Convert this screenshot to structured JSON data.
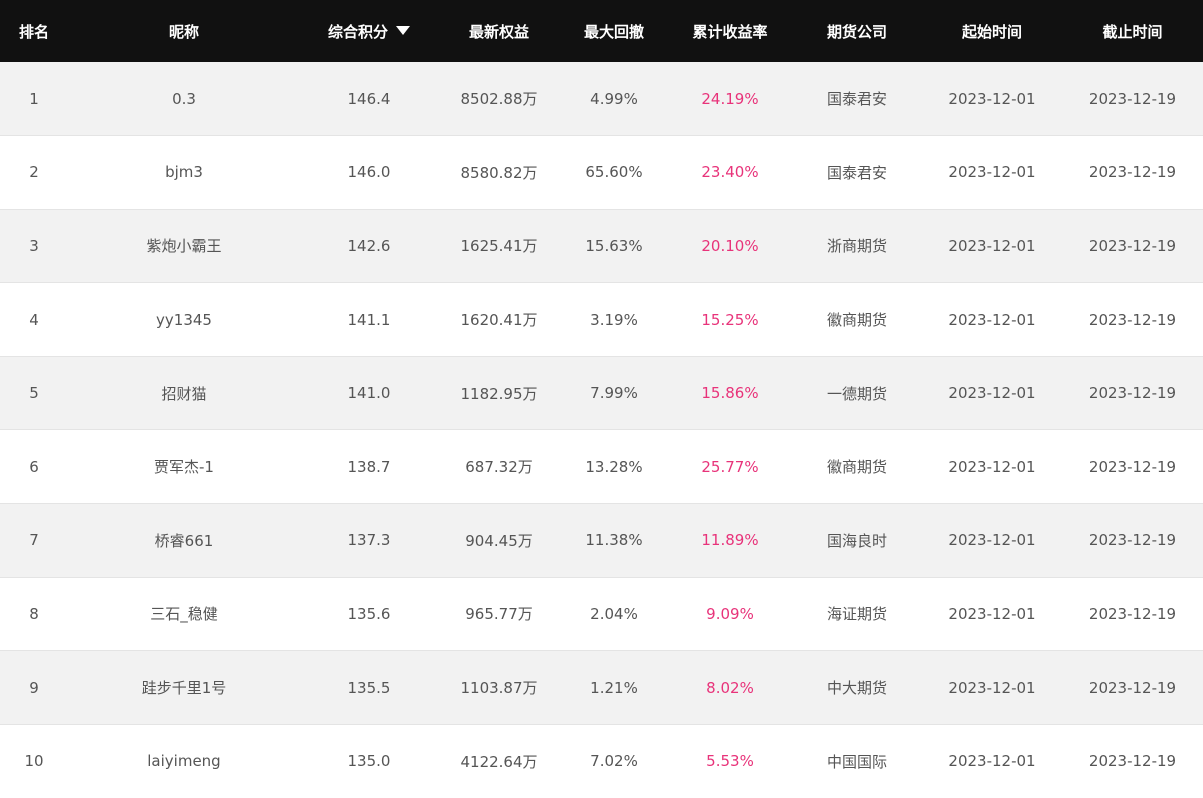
{
  "headers": {
    "rank": "排名",
    "nickname": "昵称",
    "score": "综合积分",
    "equity": "最新权益",
    "drawdown": "最大回撤",
    "return": "累计收益率",
    "company": "期货公司",
    "start": "起始时间",
    "end": "截止时间"
  },
  "sort_icon": "triangle-down-icon",
  "accent_color": "#e8337a",
  "rows": [
    {
      "rank": "1",
      "nickname": "0.3",
      "score": "146.4",
      "equity": "8502.88万",
      "drawdown": "4.99%",
      "return": "24.19%",
      "company": "国泰君安",
      "start": "2023-12-01",
      "end": "2023-12-19"
    },
    {
      "rank": "2",
      "nickname": "bjm3",
      "score": "146.0",
      "equity": "8580.82万",
      "drawdown": "65.60%",
      "return": "23.40%",
      "company": "国泰君安",
      "start": "2023-12-01",
      "end": "2023-12-19"
    },
    {
      "rank": "3",
      "nickname": "紫炮小霸王",
      "score": "142.6",
      "equity": "1625.41万",
      "drawdown": "15.63%",
      "return": "20.10%",
      "company": "浙商期货",
      "start": "2023-12-01",
      "end": "2023-12-19"
    },
    {
      "rank": "4",
      "nickname": "yy1345",
      "score": "141.1",
      "equity": "1620.41万",
      "drawdown": "3.19%",
      "return": "15.25%",
      "company": "徽商期货",
      "start": "2023-12-01",
      "end": "2023-12-19"
    },
    {
      "rank": "5",
      "nickname": "招财猫",
      "score": "141.0",
      "equity": "1182.95万",
      "drawdown": "7.99%",
      "return": "15.86%",
      "company": "一德期货",
      "start": "2023-12-01",
      "end": "2023-12-19"
    },
    {
      "rank": "6",
      "nickname": "贾军杰-1",
      "score": "138.7",
      "equity": "687.32万",
      "drawdown": "13.28%",
      "return": "25.77%",
      "company": "徽商期货",
      "start": "2023-12-01",
      "end": "2023-12-19"
    },
    {
      "rank": "7",
      "nickname": "桥睿661",
      "score": "137.3",
      "equity": "904.45万",
      "drawdown": "11.38%",
      "return": "11.89%",
      "company": "国海良时",
      "start": "2023-12-01",
      "end": "2023-12-19"
    },
    {
      "rank": "8",
      "nickname": "三石_稳健",
      "score": "135.6",
      "equity": "965.77万",
      "drawdown": "2.04%",
      "return": "9.09%",
      "company": "海证期货",
      "start": "2023-12-01",
      "end": "2023-12-19"
    },
    {
      "rank": "9",
      "nickname": "跬步千里1号",
      "score": "135.5",
      "equity": "1103.87万",
      "drawdown": "1.21%",
      "return": "8.02%",
      "company": "中大期货",
      "start": "2023-12-01",
      "end": "2023-12-19"
    },
    {
      "rank": "10",
      "nickname": "laiyimeng",
      "score": "135.0",
      "equity": "4122.64万",
      "drawdown": "7.02%",
      "return": "5.53%",
      "company": "中国国际",
      "start": "2023-12-01",
      "end": "2023-12-19"
    }
  ]
}
